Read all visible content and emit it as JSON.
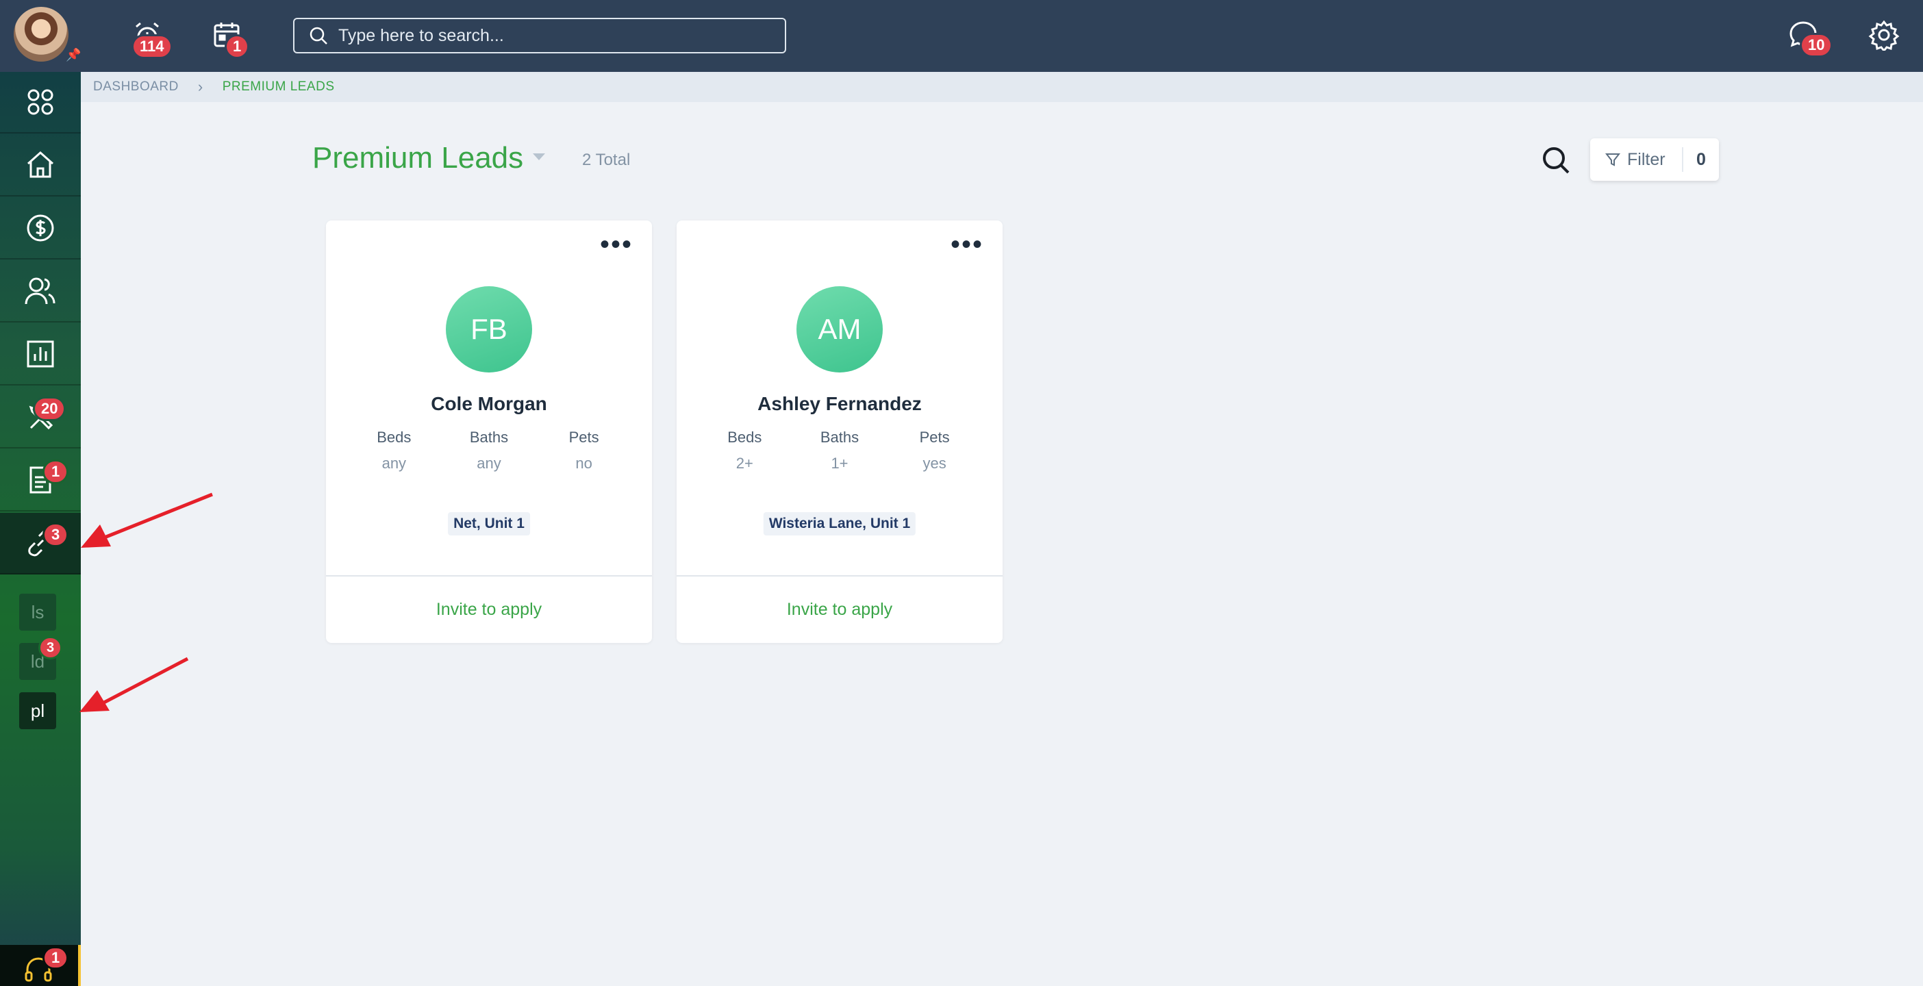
{
  "topbar": {
    "alarm_badge": "114",
    "calendar_badge": "1",
    "search_placeholder": "Type here to search...",
    "chat_badge": "10"
  },
  "sidebar": {
    "tools_badge": "20",
    "documents_badge": "1",
    "links_badge": "3",
    "sub_items": [
      {
        "label": "ls",
        "badge": ""
      },
      {
        "label": "ld",
        "badge": "3"
      },
      {
        "label": "pl",
        "badge": ""
      }
    ],
    "help_badge": "1"
  },
  "breadcrumb": {
    "parent": "DASHBOARD",
    "current": "PREMIUM LEADS"
  },
  "main": {
    "title": "Premium Leads",
    "total": "2 Total",
    "filter_label": "Filter",
    "filter_count": "0"
  },
  "cards": [
    {
      "initials": "FB",
      "name": "Cole Morgan",
      "beds_label": "Beds",
      "beds": "any",
      "baths_label": "Baths",
      "baths": "any",
      "pets_label": "Pets",
      "pets": "no",
      "unit": "Net, Unit 1",
      "action": "Invite to apply"
    },
    {
      "initials": "AM",
      "name": "Ashley Fernandez",
      "beds_label": "Beds",
      "beds": "2+",
      "baths_label": "Baths",
      "baths": "1+",
      "pets_label": "Pets",
      "pets": "yes",
      "unit": "Wisteria Lane, Unit 1",
      "action": "Invite to apply"
    }
  ],
  "colors": {
    "accent_green": "#3aa548",
    "topbar": "#2f4158",
    "badge_red": "#e0404a",
    "annotation_red": "#e5202a"
  }
}
